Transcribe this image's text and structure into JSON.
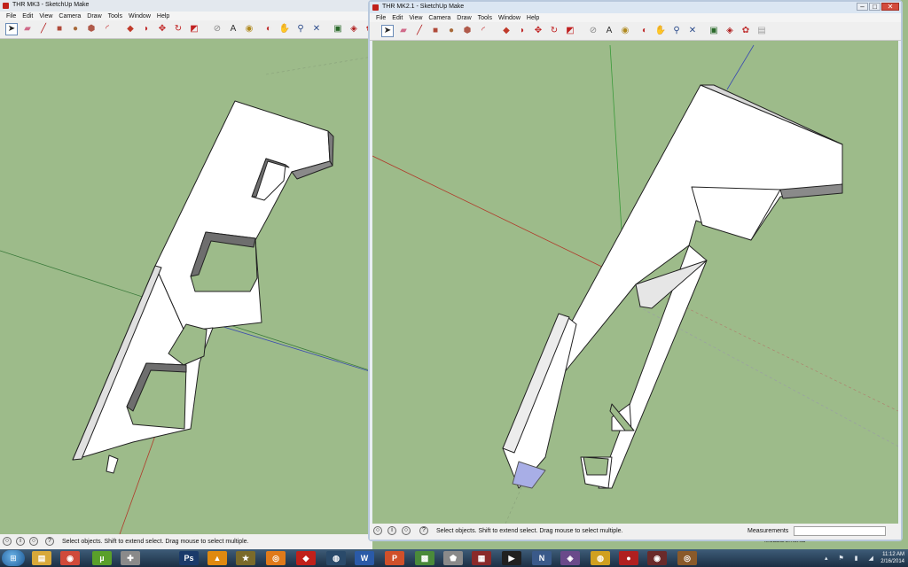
{
  "left_window": {
    "title": "THR MK3 - SketchUp Make",
    "menu": [
      "File",
      "Edit",
      "View",
      "Camera",
      "Draw",
      "Tools",
      "Window",
      "Help"
    ],
    "status_text": "Select objects. Shift to extend select. Drag mouse to select multiple."
  },
  "right_window": {
    "title": "THR MK2.1 - SketchUp Make",
    "menu": [
      "File",
      "Edit",
      "View",
      "Camera",
      "Draw",
      "Tools",
      "Window",
      "Help"
    ],
    "status_text": "Select objects. Shift to extend select. Drag mouse to select multiple.",
    "measurements_label": "Measurements",
    "window_buttons": {
      "minimize": "–",
      "maximize": "□",
      "close": "✕"
    }
  },
  "behind_measurements_label": "Measurements",
  "toolbar_icons": [
    {
      "name": "select-arrow-icon",
      "glyph": "➤",
      "color": "#222222"
    },
    {
      "name": "eraser-icon",
      "glyph": "▰",
      "color": "#d06a8a"
    },
    {
      "name": "pencil-line-icon",
      "glyph": "╱",
      "color": "#b01818"
    },
    {
      "name": "rectangle-icon",
      "glyph": "■",
      "color": "#b04a3a"
    },
    {
      "name": "circle-icon",
      "glyph": "●",
      "color": "#a86a3a"
    },
    {
      "name": "polygon-icon",
      "glyph": "⬢",
      "color": "#b05a4a"
    },
    {
      "name": "arc-icon",
      "glyph": "◜",
      "color": "#c02020"
    },
    {
      "name": "push-pull-icon",
      "glyph": "◆",
      "color": "#c03a2a"
    },
    {
      "name": "follow-me-icon",
      "glyph": "◗",
      "color": "#c02a2a"
    },
    {
      "name": "move-icon",
      "glyph": "✥",
      "color": "#c02020"
    },
    {
      "name": "rotate-icon",
      "glyph": "↻",
      "color": "#c02020"
    },
    {
      "name": "scale-icon",
      "glyph": "◩",
      "color": "#c02020"
    },
    {
      "name": "tape-measure-icon",
      "glyph": "⊘",
      "color": "#888888"
    },
    {
      "name": "text-icon",
      "glyph": "A",
      "color": "#333333"
    },
    {
      "name": "paint-bucket-icon",
      "glyph": "◉",
      "color": "#b08a20"
    },
    {
      "name": "orbit-icon",
      "glyph": "◐",
      "color": "#c03030"
    },
    {
      "name": "pan-icon",
      "glyph": "✋",
      "color": "#555555"
    },
    {
      "name": "zoom-icon",
      "glyph": "⚲",
      "color": "#2a4a8a"
    },
    {
      "name": "zoom-extents-icon",
      "glyph": "✕",
      "color": "#2a4a8a"
    },
    {
      "name": "warehouse-icon",
      "glyph": "▣",
      "color": "#2a6a2a"
    },
    {
      "name": "share-model-icon",
      "glyph": "◈",
      "color": "#b02020"
    },
    {
      "name": "extension-warehouse-icon",
      "glyph": "✿",
      "color": "#c03030"
    },
    {
      "name": "layout-icon",
      "glyph": "▤",
      "color": "#a0a0a0"
    }
  ],
  "status_icons": [
    "geo-location-icon",
    "credits-icon",
    "user-icon",
    "help-icon"
  ],
  "status_glyphs": [
    "○",
    "i",
    "○",
    "?"
  ],
  "taskbar": {
    "apps": [
      {
        "name": "windows-explorer-icon",
        "glyph": "▤",
        "color": "#d8a93a"
      },
      {
        "name": "chrome-icon",
        "glyph": "◉",
        "color": "#d04a3a"
      },
      {
        "name": "utorrent-icon",
        "glyph": "µ",
        "color": "#5aa02a"
      },
      {
        "name": "controller-icon",
        "glyph": "✚",
        "color": "#8a8a8a"
      },
      {
        "name": "photoshop-icon",
        "glyph": "Ps",
        "color": "#1a3a6a"
      },
      {
        "name": "vlc-icon",
        "glyph": "▲",
        "color": "#e08a10"
      },
      {
        "name": "game-icon",
        "glyph": "★",
        "color": "#7a6a2a"
      },
      {
        "name": "blender-icon",
        "glyph": "◎",
        "color": "#e07a1a"
      },
      {
        "name": "sketchup-icon",
        "glyph": "◆",
        "color": "#c0201a"
      },
      {
        "name": "steam-icon",
        "glyph": "◍",
        "color": "#2a4a6a"
      },
      {
        "name": "word-icon",
        "glyph": "W",
        "color": "#2a5aa8"
      },
      {
        "name": "powerpoint-icon",
        "glyph": "P",
        "color": "#d0502a"
      },
      {
        "name": "minecraft-icon",
        "glyph": "▩",
        "color": "#4a8a3a"
      },
      {
        "name": "skyrim-icon",
        "glyph": "⬟",
        "color": "#8a8a8a"
      },
      {
        "name": "game-icon-2",
        "glyph": "▦",
        "color": "#8a2a2a"
      },
      {
        "name": "forza-icon",
        "glyph": "▶",
        "color": "#202020"
      },
      {
        "name": "nfs-icon",
        "glyph": "N",
        "color": "#3a5a8a"
      },
      {
        "name": "game-icon-3",
        "glyph": "◈",
        "color": "#6a4a8a"
      },
      {
        "name": "game-icon-4",
        "glyph": "◍",
        "color": "#d0a020"
      },
      {
        "name": "game-icon-5",
        "glyph": "●",
        "color": "#b02020"
      },
      {
        "name": "game-icon-6",
        "glyph": "◉",
        "color": "#6a2a2a"
      },
      {
        "name": "game-icon-7",
        "glyph": "◎",
        "color": "#8a5a2a"
      }
    ],
    "clock_time": "11:12 AM",
    "clock_date": "2/16/2014"
  }
}
